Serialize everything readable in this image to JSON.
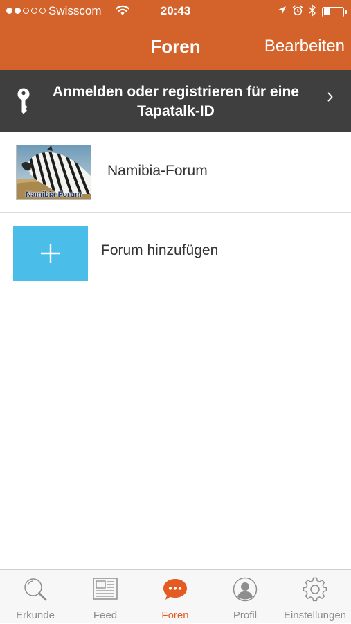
{
  "status_bar": {
    "carrier": "Swisscom",
    "time": "20:43",
    "signal_bars_filled": 2,
    "signal_bars_total": 5,
    "battery_level": 0.35,
    "icons": [
      "wifi-icon",
      "location-arrow-icon",
      "alarm-clock-icon",
      "bluetooth-icon",
      "battery-icon"
    ]
  },
  "nav": {
    "title": "Foren",
    "edit_label": "Bearbeiten"
  },
  "login_banner": {
    "line1": "Anmelden oder registrieren für eine",
    "line2": "Tapatalk-ID",
    "icon": "key-icon",
    "chevron": "›"
  },
  "forums": [
    {
      "name": "Namibia-Forum",
      "thumbnail_caption": "Namibia-Forum",
      "thumbnail": "zebra-photo"
    }
  ],
  "add_forum": {
    "label": "Forum hinzufügen",
    "symbol": "+"
  },
  "tabs": [
    {
      "label": "Erkunde",
      "icon": "search-icon",
      "active": false
    },
    {
      "label": "Feed",
      "icon": "newspaper-icon",
      "active": false
    },
    {
      "label": "Foren",
      "icon": "chat-bubble-icon",
      "active": true
    },
    {
      "label": "Profil",
      "icon": "user-icon",
      "active": false
    },
    {
      "label": "Einstellungen",
      "icon": "gear-icon",
      "active": false
    }
  ],
  "colors": {
    "header_bg": "#d4622b",
    "login_bg": "#3f3f3f",
    "add_button_bg": "#4bbde9",
    "tab_active": "#e35a22",
    "tab_inactive": "#8e8e8e",
    "tabbar_bg": "#f7f7f7"
  }
}
